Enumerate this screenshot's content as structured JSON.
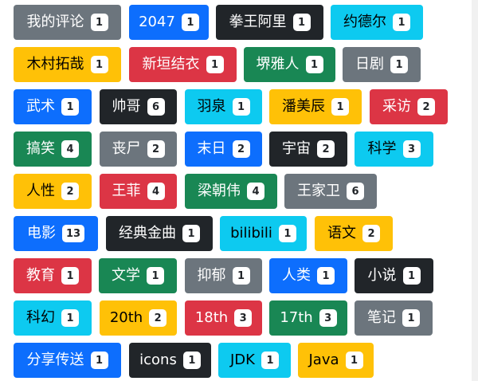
{
  "colors": {
    "gray": "#6c757d",
    "blue": "#0d6efd",
    "dark": "#212529",
    "cyan": "#0dcaf0",
    "yellow": "#ffc107",
    "red": "#dc3545",
    "green": "#198754"
  },
  "tags": [
    {
      "label": "我的评论",
      "count": "1"
    },
    {
      "label": "2047",
      "count": "1"
    },
    {
      "label": "拳王阿里",
      "count": "1"
    },
    {
      "label": "约德尔",
      "count": "1"
    },
    {
      "label": "木村拓哉",
      "count": "1"
    },
    {
      "label": "新垣结衣",
      "count": "1"
    },
    {
      "label": "堺雅人",
      "count": "1"
    },
    {
      "label": "日剧",
      "count": "1"
    },
    {
      "label": "武术",
      "count": "1"
    },
    {
      "label": "帅哥",
      "count": "6"
    },
    {
      "label": "羽泉",
      "count": "1"
    },
    {
      "label": "潘美辰",
      "count": "1"
    },
    {
      "label": "采访",
      "count": "2"
    },
    {
      "label": "搞笑",
      "count": "4"
    },
    {
      "label": "丧尸",
      "count": "2"
    },
    {
      "label": "末日",
      "count": "2"
    },
    {
      "label": "宇宙",
      "count": "2"
    },
    {
      "label": "科学",
      "count": "3"
    },
    {
      "label": "人性",
      "count": "2"
    },
    {
      "label": "王菲",
      "count": "4"
    },
    {
      "label": "梁朝伟",
      "count": "4"
    },
    {
      "label": "王家卫",
      "count": "6"
    },
    {
      "label": "电影",
      "count": "13"
    },
    {
      "label": "经典金曲",
      "count": "1"
    },
    {
      "label": "bilibili",
      "count": "1"
    },
    {
      "label": "语文",
      "count": "2"
    },
    {
      "label": "教育",
      "count": "1"
    },
    {
      "label": "文学",
      "count": "1"
    },
    {
      "label": "抑郁",
      "count": "1"
    },
    {
      "label": "人类",
      "count": "1"
    },
    {
      "label": "小说",
      "count": "1"
    },
    {
      "label": "科幻",
      "count": "1"
    },
    {
      "label": "20th",
      "count": "2"
    },
    {
      "label": "18th",
      "count": "3"
    },
    {
      "label": "17th",
      "count": "3"
    },
    {
      "label": "笔记",
      "count": "1"
    },
    {
      "label": "分享传送",
      "count": "1"
    },
    {
      "label": "icons",
      "count": "1"
    },
    {
      "label": "JDK",
      "count": "1"
    },
    {
      "label": "Java",
      "count": "1"
    }
  ]
}
